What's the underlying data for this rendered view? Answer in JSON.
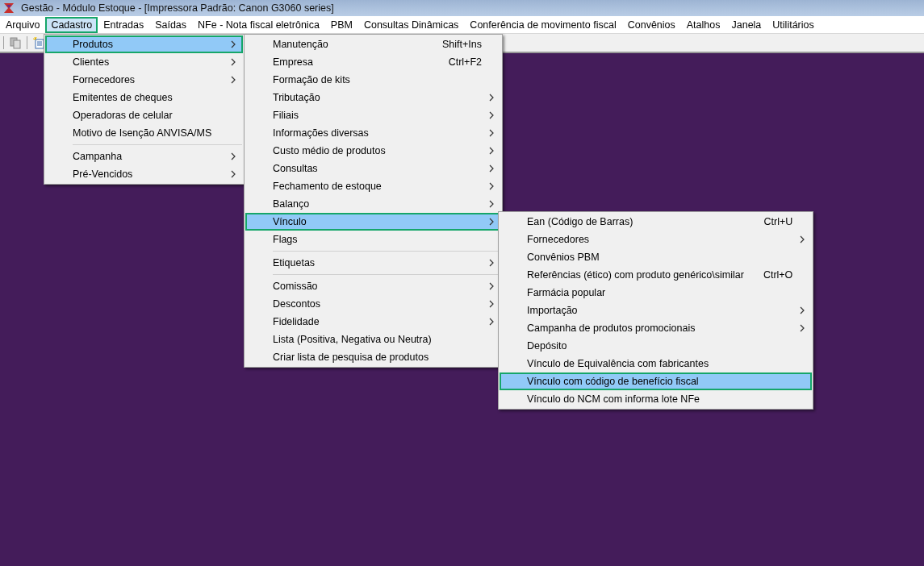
{
  "window": {
    "title": "Gestão  - Módulo Estoque - [Impressora Padrão: Canon G3060 series]"
  },
  "menubar": [
    {
      "label": "Arquivo",
      "selected": false
    },
    {
      "label": "Cadastro",
      "selected": true
    },
    {
      "label": "Entradas",
      "selected": false
    },
    {
      "label": "Saídas",
      "selected": false
    },
    {
      "label": "NFe - Nota fiscal eletrônica",
      "selected": false
    },
    {
      "label": "PBM",
      "selected": false
    },
    {
      "label": "Consultas Dinâmicas",
      "selected": false
    },
    {
      "label": "Conferência de movimento fiscal",
      "selected": false
    },
    {
      "label": "Convênios",
      "selected": false
    },
    {
      "label": "Atalhos",
      "selected": false
    },
    {
      "label": "Janela",
      "selected": false
    },
    {
      "label": "Utilitários",
      "selected": false
    }
  ],
  "menus": [
    {
      "items": [
        {
          "kind": "item",
          "label": "Produtos",
          "submenu": true,
          "selected": true
        },
        {
          "kind": "item",
          "label": "Clientes",
          "submenu": true,
          "selected": false
        },
        {
          "kind": "item",
          "label": "Fornecedores",
          "submenu": true,
          "selected": false
        },
        {
          "kind": "item",
          "label": "Emitentes de cheques",
          "submenu": false,
          "selected": false
        },
        {
          "kind": "item",
          "label": "Operadoras de celular",
          "submenu": false,
          "selected": false
        },
        {
          "kind": "item",
          "label": "Motivo de Isenção ANVISA/MS",
          "submenu": false,
          "selected": false
        },
        {
          "kind": "separator"
        },
        {
          "kind": "item",
          "label": "Campanha",
          "submenu": true,
          "selected": false
        },
        {
          "kind": "item",
          "label": "Pré-Vencidos",
          "submenu": true,
          "selected": false
        }
      ]
    },
    {
      "items": [
        {
          "kind": "item",
          "label": "Manutenção",
          "shortcut": "Shift+Ins",
          "submenu": false,
          "selected": false
        },
        {
          "kind": "item",
          "label": "Empresa",
          "shortcut": "Ctrl+F2",
          "submenu": false,
          "selected": false
        },
        {
          "kind": "item",
          "label": "Formação de kits",
          "submenu": false,
          "selected": false
        },
        {
          "kind": "item",
          "label": "Tributação",
          "submenu": true,
          "selected": false
        },
        {
          "kind": "item",
          "label": "Filiais",
          "submenu": true,
          "selected": false
        },
        {
          "kind": "item",
          "label": "Informações diversas",
          "submenu": true,
          "selected": false
        },
        {
          "kind": "item",
          "label": "Custo médio de produtos",
          "submenu": true,
          "selected": false
        },
        {
          "kind": "item",
          "label": "Consultas",
          "submenu": true,
          "selected": false
        },
        {
          "kind": "item",
          "label": "Fechamento de estoque",
          "submenu": true,
          "selected": false
        },
        {
          "kind": "item",
          "label": "Balanço",
          "submenu": true,
          "selected": false
        },
        {
          "kind": "item",
          "label": "Vínculo",
          "submenu": true,
          "selected": true
        },
        {
          "kind": "item",
          "label": "Flags",
          "submenu": false,
          "selected": false
        },
        {
          "kind": "separator"
        },
        {
          "kind": "item",
          "label": "Etiquetas",
          "submenu": true,
          "selected": false
        },
        {
          "kind": "separator"
        },
        {
          "kind": "item",
          "label": "Comissão",
          "submenu": true,
          "selected": false
        },
        {
          "kind": "item",
          "label": "Descontos",
          "submenu": true,
          "selected": false
        },
        {
          "kind": "item",
          "label": "Fidelidade",
          "submenu": true,
          "selected": false
        },
        {
          "kind": "item",
          "label": "Lista (Positiva, Negativa ou Neutra)",
          "submenu": false,
          "selected": false
        },
        {
          "kind": "item",
          "label": "Criar lista de pesquisa de produtos",
          "submenu": false,
          "selected": false
        }
      ]
    },
    {
      "items": [
        {
          "kind": "item",
          "label": "Ean (Código de Barras)",
          "shortcut": "Ctrl+U",
          "submenu": false,
          "selected": false
        },
        {
          "kind": "item",
          "label": "Fornecedores",
          "submenu": true,
          "selected": false
        },
        {
          "kind": "item",
          "label": "Convênios PBM",
          "submenu": false,
          "selected": false
        },
        {
          "kind": "item",
          "label": "Referências (ético) com produto genérico\\similar",
          "shortcut": "Ctrl+O",
          "submenu": false,
          "selected": false
        },
        {
          "kind": "item",
          "label": "Farmácia popular",
          "submenu": false,
          "selected": false
        },
        {
          "kind": "item",
          "label": "Importação",
          "submenu": true,
          "selected": false
        },
        {
          "kind": "item",
          "label": "Campanha de produtos promocionais",
          "submenu": true,
          "selected": false
        },
        {
          "kind": "item",
          "label": "Depósito",
          "submenu": false,
          "selected": false
        },
        {
          "kind": "item",
          "label": "Vínculo de Equivalência com fabricantes",
          "submenu": false,
          "selected": false
        },
        {
          "kind": "item",
          "label": "Vínculo com código de benefício fiscal",
          "submenu": false,
          "selected": true
        },
        {
          "kind": "item",
          "label": "Vínculo do NCM com informa lote NFe",
          "submenu": false,
          "selected": false
        }
      ]
    }
  ]
}
